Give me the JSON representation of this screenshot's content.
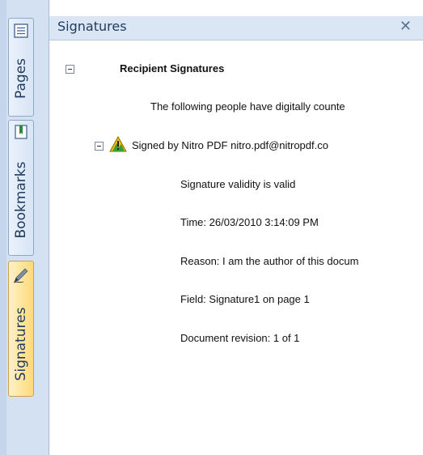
{
  "panel": {
    "title": "Signatures",
    "close_label": "✕"
  },
  "tabs": [
    {
      "label": "Pages",
      "icon": "pages-icon"
    },
    {
      "label": "Bookmarks",
      "icon": "bookmark-icon"
    },
    {
      "label": "Signatures",
      "icon": "pen-icon",
      "active": true
    }
  ],
  "tree": {
    "section_title": "Recipient Signatures",
    "intro": "The following people have digitally counte",
    "signer": "Signed by Nitro PDF nitro.pdf@nitropdf.co",
    "signer_status_icon": "warning-icon",
    "details": {
      "validity": "Signature validity is valid",
      "time": "Time: 26/03/2010 3:14:09 PM",
      "reason": "Reason: I am the author of this docum",
      "field": "Field: Signature1 on page 1",
      "revision": "Document revision: 1 of 1"
    }
  },
  "colors": {
    "tabstrip_bg": "#d4e1f2",
    "header_bg": "#dbe6f4",
    "active_tab": "#ffd97a",
    "warning": "#f2c200"
  }
}
